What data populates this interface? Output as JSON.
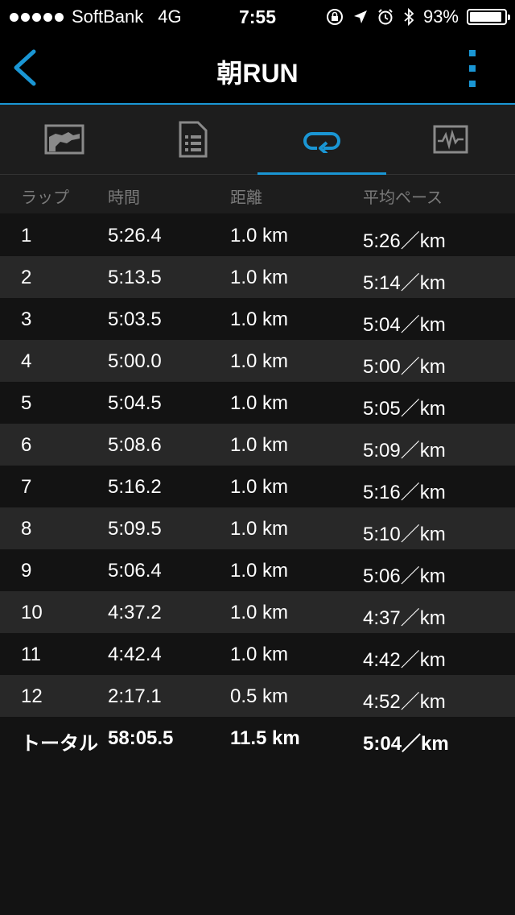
{
  "status_bar": {
    "carrier": "SoftBank",
    "network": "4G",
    "time": "7:55",
    "battery_percent": "93%",
    "battery_level": 0.93
  },
  "nav": {
    "title": "朝RUN"
  },
  "tabs": [
    {
      "icon": "chart-icon",
      "active": false
    },
    {
      "icon": "document-list-icon",
      "active": false
    },
    {
      "icon": "laps-loop-icon",
      "active": true
    },
    {
      "icon": "heart-rate-monitor-icon",
      "active": false
    }
  ],
  "table": {
    "headers": {
      "lap": "ラップ",
      "time": "時間",
      "distance": "距離",
      "pace": "平均ペース"
    },
    "rows": [
      {
        "lap": "1",
        "time": "5:26.4",
        "distance": "1.0 km",
        "pace": "5:26／km"
      },
      {
        "lap": "2",
        "time": "5:13.5",
        "distance": "1.0 km",
        "pace": "5:14／km"
      },
      {
        "lap": "3",
        "time": "5:03.5",
        "distance": "1.0 km",
        "pace": "5:04／km"
      },
      {
        "lap": "4",
        "time": "5:00.0",
        "distance": "1.0 km",
        "pace": "5:00／km"
      },
      {
        "lap": "5",
        "time": "5:04.5",
        "distance": "1.0 km",
        "pace": "5:05／km"
      },
      {
        "lap": "6",
        "time": "5:08.6",
        "distance": "1.0 km",
        "pace": "5:09／km"
      },
      {
        "lap": "7",
        "time": "5:16.2",
        "distance": "1.0 km",
        "pace": "5:16／km"
      },
      {
        "lap": "8",
        "time": "5:09.5",
        "distance": "1.0 km",
        "pace": "5:10／km"
      },
      {
        "lap": "9",
        "time": "5:06.4",
        "distance": "1.0 km",
        "pace": "5:06／km"
      },
      {
        "lap": "10",
        "time": "4:37.2",
        "distance": "1.0 km",
        "pace": "4:37／km"
      },
      {
        "lap": "11",
        "time": "4:42.4",
        "distance": "1.0 km",
        "pace": "4:42／km"
      },
      {
        "lap": "12",
        "time": "2:17.1",
        "distance": "0.5 km",
        "pace": "4:52／km"
      }
    ],
    "total": {
      "label": "トータル",
      "time": "58:05.5",
      "distance": "11.5 km",
      "pace": "5:04／km"
    }
  },
  "colors": {
    "accent": "#1a96d4",
    "background": "#131313",
    "row_alt": "#282828",
    "header_text": "#7a7a7a"
  }
}
